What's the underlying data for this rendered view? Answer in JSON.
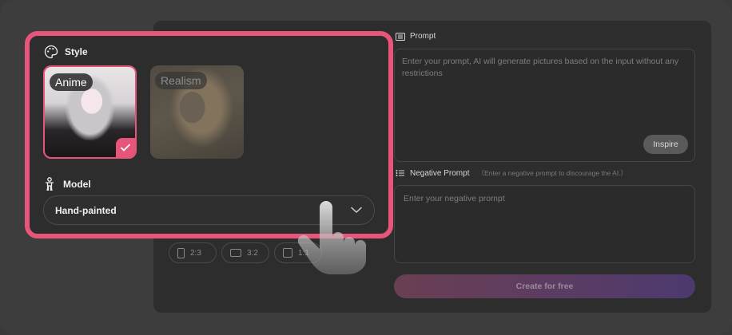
{
  "style": {
    "title": "Style",
    "options": [
      {
        "label": "Anime",
        "selected": true
      },
      {
        "label": "Realism",
        "selected": false
      }
    ]
  },
  "model": {
    "title": "Model",
    "value": "Hand-painted"
  },
  "aspect_ratios": [
    "2:3",
    "3:2",
    "1:1"
  ],
  "prompt": {
    "label": "Prompt",
    "placeholder": "Enter your prompt, AI will generate pictures based on the input without any restrictions",
    "inspire_label": "Inspire"
  },
  "negative_prompt": {
    "label": "Negative Prompt",
    "hint": "（Enter a negative prompt to discourage the AI.）",
    "placeholder": "Enter your negative prompt"
  },
  "create_label": "Create for free",
  "colors": {
    "accent": "#e8557a",
    "panel": "#2d2d2d",
    "background": "#3d3d3d"
  }
}
